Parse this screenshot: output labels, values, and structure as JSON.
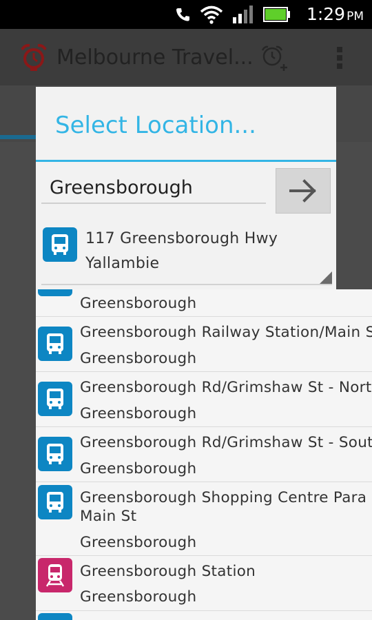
{
  "status_bar": {
    "time": "1:29",
    "ampm": "PM",
    "icons": [
      "phone-silent-icon",
      "wifi-icon",
      "signal-icon",
      "battery-icon"
    ]
  },
  "action_bar": {
    "app_title": "Melbourne Travel...",
    "icons": [
      "alarm-clock-app-icon",
      "add-alarm-icon",
      "overflow-menu-icon"
    ]
  },
  "dialog": {
    "title": "Select Location...",
    "search_value": "Greensborough",
    "go_button_icon": "arrow-right-icon",
    "selected": {
      "type": "bus",
      "name": "117 Greensborough Hwy",
      "suburb": "Yallambie"
    }
  },
  "suggestions": [
    {
      "type": "bus",
      "name": "",
      "suburb": "Greensborough"
    },
    {
      "type": "bus",
      "name": "Greensborough Railway Station/Main St",
      "suburb": "Greensborough"
    },
    {
      "type": "bus",
      "name": "Greensborough Rd/Grimshaw St - North",
      "suburb": "Greensborough"
    },
    {
      "type": "bus",
      "name": "Greensborough Rd/Grimshaw St - South",
      "suburb": "Greensborough"
    },
    {
      "type": "bus",
      "name": "Greensborough Shopping Centre Para Rd/",
      "name_line2": "Main St",
      "suburb": "Greensborough"
    },
    {
      "type": "train",
      "name": "Greensborough Station",
      "suburb": "Greensborough"
    }
  ],
  "colors": {
    "accent": "#33b5e5",
    "bus": "#0d86c3",
    "train": "#c8276b"
  }
}
